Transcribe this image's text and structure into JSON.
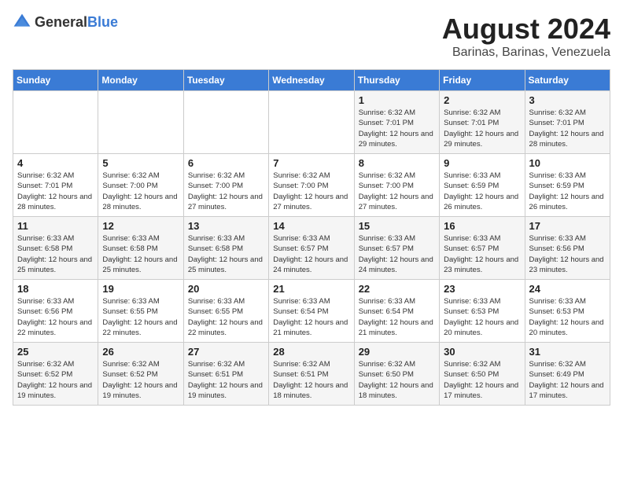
{
  "header": {
    "logo_general": "General",
    "logo_blue": "Blue",
    "month_year": "August 2024",
    "location": "Barinas, Barinas, Venezuela"
  },
  "days_of_week": [
    "Sunday",
    "Monday",
    "Tuesday",
    "Wednesday",
    "Thursday",
    "Friday",
    "Saturday"
  ],
  "weeks": [
    [
      {
        "day": "",
        "info": ""
      },
      {
        "day": "",
        "info": ""
      },
      {
        "day": "",
        "info": ""
      },
      {
        "day": "",
        "info": ""
      },
      {
        "day": "1",
        "info": "Sunrise: 6:32 AM\nSunset: 7:01 PM\nDaylight: 12 hours\nand 29 minutes."
      },
      {
        "day": "2",
        "info": "Sunrise: 6:32 AM\nSunset: 7:01 PM\nDaylight: 12 hours\nand 29 minutes."
      },
      {
        "day": "3",
        "info": "Sunrise: 6:32 AM\nSunset: 7:01 PM\nDaylight: 12 hours\nand 28 minutes."
      }
    ],
    [
      {
        "day": "4",
        "info": "Sunrise: 6:32 AM\nSunset: 7:01 PM\nDaylight: 12 hours\nand 28 minutes."
      },
      {
        "day": "5",
        "info": "Sunrise: 6:32 AM\nSunset: 7:00 PM\nDaylight: 12 hours\nand 28 minutes."
      },
      {
        "day": "6",
        "info": "Sunrise: 6:32 AM\nSunset: 7:00 PM\nDaylight: 12 hours\nand 27 minutes."
      },
      {
        "day": "7",
        "info": "Sunrise: 6:32 AM\nSunset: 7:00 PM\nDaylight: 12 hours\nand 27 minutes."
      },
      {
        "day": "8",
        "info": "Sunrise: 6:32 AM\nSunset: 7:00 PM\nDaylight: 12 hours\nand 27 minutes."
      },
      {
        "day": "9",
        "info": "Sunrise: 6:33 AM\nSunset: 6:59 PM\nDaylight: 12 hours\nand 26 minutes."
      },
      {
        "day": "10",
        "info": "Sunrise: 6:33 AM\nSunset: 6:59 PM\nDaylight: 12 hours\nand 26 minutes."
      }
    ],
    [
      {
        "day": "11",
        "info": "Sunrise: 6:33 AM\nSunset: 6:58 PM\nDaylight: 12 hours\nand 25 minutes."
      },
      {
        "day": "12",
        "info": "Sunrise: 6:33 AM\nSunset: 6:58 PM\nDaylight: 12 hours\nand 25 minutes."
      },
      {
        "day": "13",
        "info": "Sunrise: 6:33 AM\nSunset: 6:58 PM\nDaylight: 12 hours\nand 25 minutes."
      },
      {
        "day": "14",
        "info": "Sunrise: 6:33 AM\nSunset: 6:57 PM\nDaylight: 12 hours\nand 24 minutes."
      },
      {
        "day": "15",
        "info": "Sunrise: 6:33 AM\nSunset: 6:57 PM\nDaylight: 12 hours\nand 24 minutes."
      },
      {
        "day": "16",
        "info": "Sunrise: 6:33 AM\nSunset: 6:57 PM\nDaylight: 12 hours\nand 23 minutes."
      },
      {
        "day": "17",
        "info": "Sunrise: 6:33 AM\nSunset: 6:56 PM\nDaylight: 12 hours\nand 23 minutes."
      }
    ],
    [
      {
        "day": "18",
        "info": "Sunrise: 6:33 AM\nSunset: 6:56 PM\nDaylight: 12 hours\nand 22 minutes."
      },
      {
        "day": "19",
        "info": "Sunrise: 6:33 AM\nSunset: 6:55 PM\nDaylight: 12 hours\nand 22 minutes."
      },
      {
        "day": "20",
        "info": "Sunrise: 6:33 AM\nSunset: 6:55 PM\nDaylight: 12 hours\nand 22 minutes."
      },
      {
        "day": "21",
        "info": "Sunrise: 6:33 AM\nSunset: 6:54 PM\nDaylight: 12 hours\nand 21 minutes."
      },
      {
        "day": "22",
        "info": "Sunrise: 6:33 AM\nSunset: 6:54 PM\nDaylight: 12 hours\nand 21 minutes."
      },
      {
        "day": "23",
        "info": "Sunrise: 6:33 AM\nSunset: 6:53 PM\nDaylight: 12 hours\nand 20 minutes."
      },
      {
        "day": "24",
        "info": "Sunrise: 6:33 AM\nSunset: 6:53 PM\nDaylight: 12 hours\nand 20 minutes."
      }
    ],
    [
      {
        "day": "25",
        "info": "Sunrise: 6:32 AM\nSunset: 6:52 PM\nDaylight: 12 hours\nand 19 minutes."
      },
      {
        "day": "26",
        "info": "Sunrise: 6:32 AM\nSunset: 6:52 PM\nDaylight: 12 hours\nand 19 minutes."
      },
      {
        "day": "27",
        "info": "Sunrise: 6:32 AM\nSunset: 6:51 PM\nDaylight: 12 hours\nand 19 minutes."
      },
      {
        "day": "28",
        "info": "Sunrise: 6:32 AM\nSunset: 6:51 PM\nDaylight: 12 hours\nand 18 minutes."
      },
      {
        "day": "29",
        "info": "Sunrise: 6:32 AM\nSunset: 6:50 PM\nDaylight: 12 hours\nand 18 minutes."
      },
      {
        "day": "30",
        "info": "Sunrise: 6:32 AM\nSunset: 6:50 PM\nDaylight: 12 hours\nand 17 minutes."
      },
      {
        "day": "31",
        "info": "Sunrise: 6:32 AM\nSunset: 6:49 PM\nDaylight: 12 hours\nand 17 minutes."
      }
    ]
  ]
}
